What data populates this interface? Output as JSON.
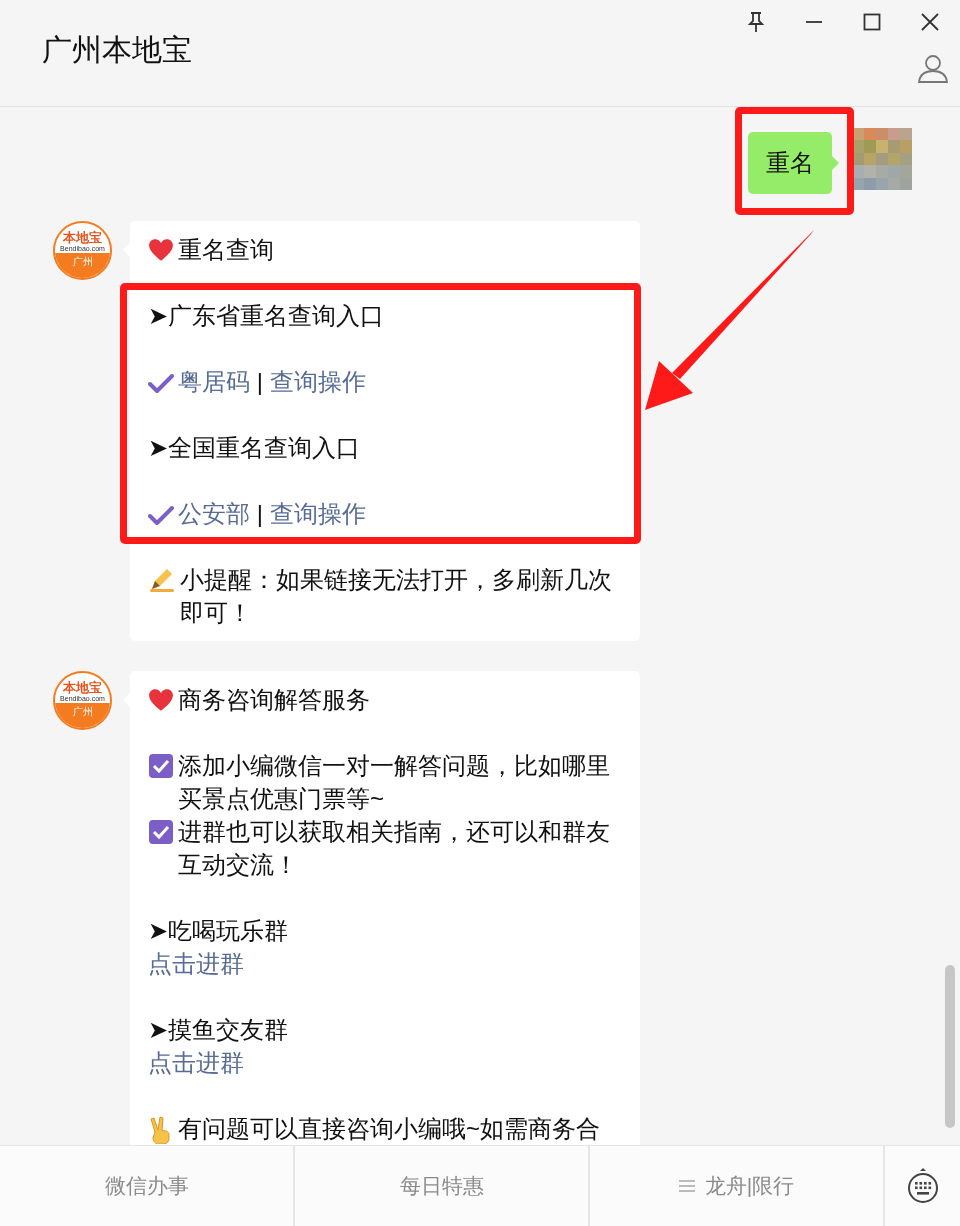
{
  "window": {
    "title": "广州本地宝"
  },
  "messages": [
    {
      "kind": "outgoing",
      "text": "重名"
    },
    {
      "kind": "incoming",
      "avatar": {
        "brand": "本地宝",
        "site": "Bendibao.com",
        "city": "广州"
      },
      "lines": [
        {
          "kind": "heading",
          "text": "重名查询"
        },
        {
          "kind": "gap"
        },
        {
          "kind": "entry",
          "text": "➤广东省重名查询入口"
        },
        {
          "kind": "gap"
        },
        {
          "kind": "links",
          "links": [
            "粤居码",
            "查询操作"
          ],
          "separator": "|"
        },
        {
          "kind": "gap"
        },
        {
          "kind": "entry",
          "text": "➤全国重名查询入口"
        },
        {
          "kind": "gap"
        },
        {
          "kind": "links",
          "links": [
            "公安部",
            "查询操作"
          ],
          "separator": "|"
        },
        {
          "kind": "gap"
        },
        {
          "kind": "tip",
          "text": "小提醒：如果链接无法打开，多刷新几次即可！"
        }
      ]
    },
    {
      "kind": "incoming",
      "avatar": {
        "brand": "本地宝",
        "site": "Bendibao.com",
        "city": "广州"
      },
      "lines": [
        {
          "kind": "heading",
          "text": "商务咨询解答服务"
        },
        {
          "kind": "gap"
        },
        {
          "kind": "checkbox",
          "text": "添加小编微信一对一解答问题，比如哪里买景点优惠门票等~"
        },
        {
          "kind": "checkbox",
          "text": "进群也可以获取相关指南，还可以和群友互动交流！"
        },
        {
          "kind": "gap"
        },
        {
          "kind": "entry",
          "text": "➤吃喝玩乐群"
        },
        {
          "kind": "link",
          "text": "点击进群"
        },
        {
          "kind": "gap"
        },
        {
          "kind": "entry",
          "text": "➤摸鱼交友群"
        },
        {
          "kind": "link",
          "text": "点击进群"
        },
        {
          "kind": "gap"
        },
        {
          "kind": "victory",
          "text": "有问题可以直接咨询小编哦~如需商务合"
        }
      ]
    }
  ],
  "menu": [
    {
      "label": "微信办事",
      "kind": "plain"
    },
    {
      "label": "每日特惠",
      "kind": "plain"
    },
    {
      "label": "龙舟|限行",
      "kind": "submenu"
    }
  ]
}
